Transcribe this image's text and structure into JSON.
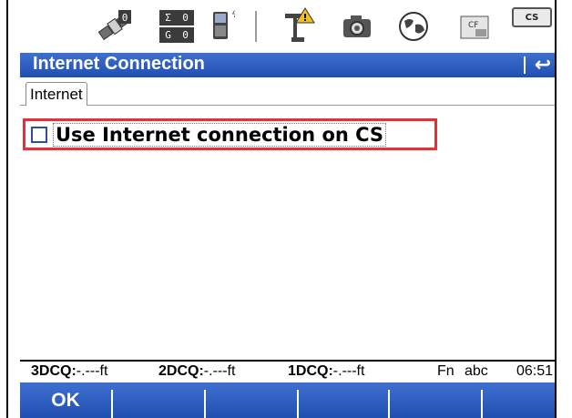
{
  "status_bar": {
    "sigma_top": [
      "Σ",
      "0"
    ],
    "sigma_bottom": [
      "G",
      "0"
    ],
    "cs_badge": "CS",
    "cf_card": "CF",
    "icons": [
      "satellite-icon",
      "sigma-counter-icon",
      "device-icon",
      "antenna-warning-icon",
      "camera-icon",
      "globe-icon",
      "cf-card-icon",
      "cs-connection-icon"
    ]
  },
  "title_bar": {
    "title": "Internet Connection",
    "back_icon": "back-arrow-icon"
  },
  "tabs": [
    {
      "label": "Internet",
      "active": true
    }
  ],
  "content": {
    "checkbox_label": "Use Internet connection on CS",
    "checked": false
  },
  "info_bar": {
    "q3_label": "3DCQ:",
    "q3_value": "-.---ft",
    "q2_label": "2DCQ:",
    "q2_value": "-.---ft",
    "q1_label": "1DCQ:",
    "q1_value": "-.---ft",
    "fn": "Fn",
    "abc": "abc",
    "time": "06:51"
  },
  "softkeys": [
    "OK",
    "",
    "",
    "",
    "",
    ""
  ],
  "colors": {
    "bar_blue": "#2a5cc0",
    "highlight_red": "#e0323a"
  }
}
